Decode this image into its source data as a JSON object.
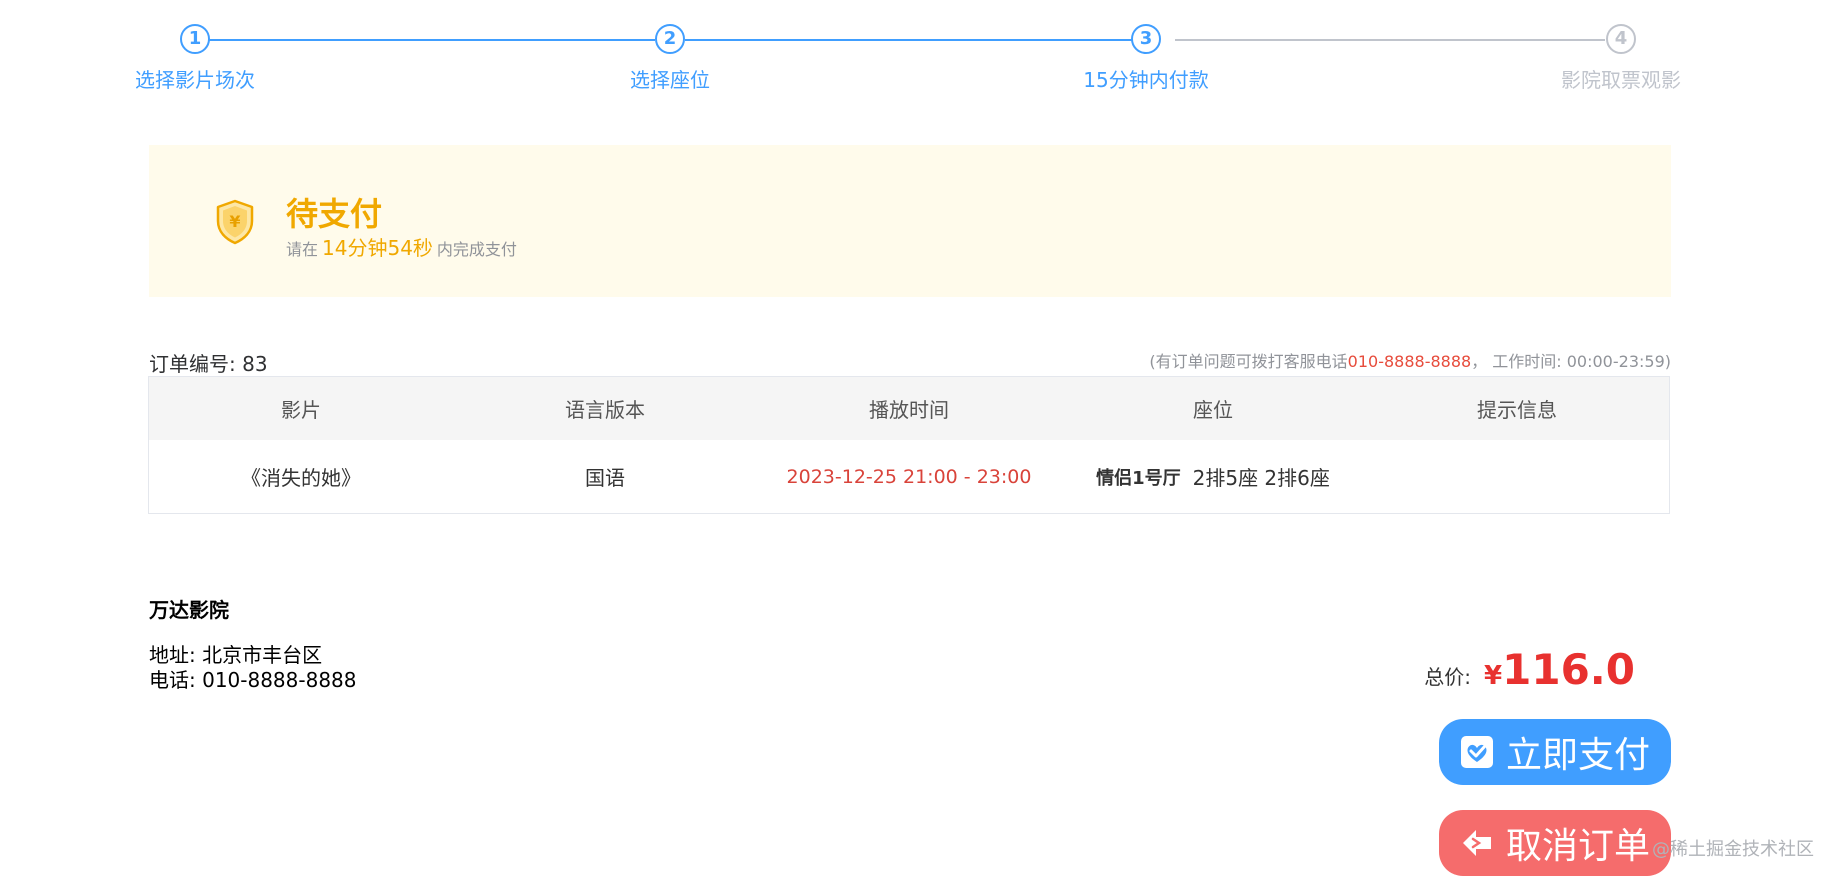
{
  "steps": [
    {
      "number": "1",
      "title": "选择影片场次"
    },
    {
      "number": "2",
      "title": "选择座位"
    },
    {
      "number": "3",
      "title": "15分钟内付款"
    },
    {
      "number": "4",
      "title": "影院取票观影"
    }
  ],
  "banner": {
    "title": "待支付",
    "prefix": "请在",
    "countdown": "14分钟54秒",
    "suffix": "内完成支付",
    "icon": "shield-yen-icon"
  },
  "order": {
    "number_label": "订单编号: 83",
    "service_prefix": "(有订单问题可拨打客服电话",
    "service_phone": "010-8888-8888",
    "service_suffix": "， 工作时间: 00:00-23:59)"
  },
  "table": {
    "headers": [
      "影片",
      "语言版本",
      "播放时间",
      "座位",
      "提示信息"
    ],
    "row": {
      "movie": "《消失的她》",
      "language": "国语",
      "time": "2023-12-25 21:00 - 23:00",
      "hall": "情侣1号厅",
      "seats": "2排5座 2排6座",
      "tip": ""
    }
  },
  "cinema": {
    "name": "万达影院",
    "address": "地址: 北京市丰台区",
    "phone": "电话: 010-8888-8888"
  },
  "payment": {
    "total_label": "总价:",
    "currency": "¥",
    "amount": "116.0",
    "pay_label": "立即支付",
    "cancel_label": "取消订单"
  },
  "watermark": "@稀土掘金技术社区",
  "colors": {
    "primary": "#409eff",
    "inactive": "#c0c4cc",
    "warning": "#f0a800",
    "danger": "#e8312f",
    "cancel": "#f56c6c",
    "banner_bg": "#fffbeb"
  }
}
